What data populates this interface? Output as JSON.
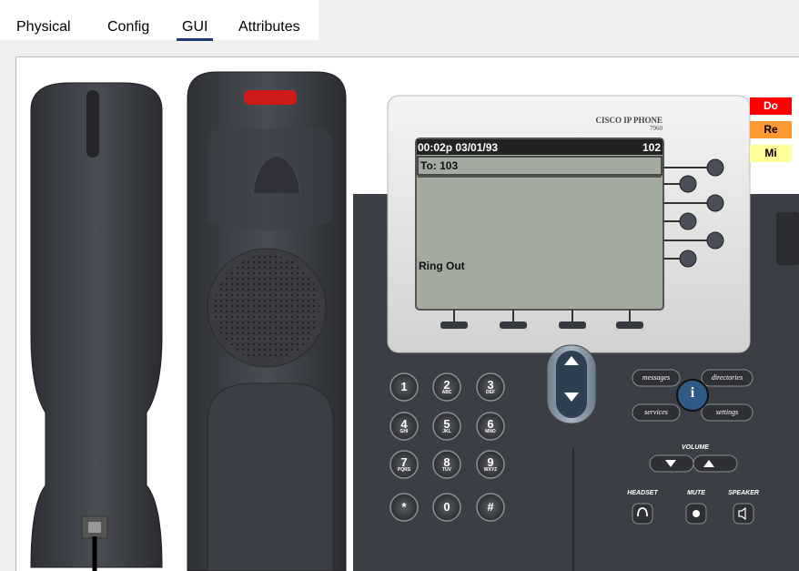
{
  "tabs": [
    {
      "label": "Physical"
    },
    {
      "label": "Config"
    },
    {
      "label": "GUI",
      "active": true
    },
    {
      "label": "Attributes"
    }
  ],
  "phone": {
    "brand": "CISCO IP PHONE",
    "model": "7960",
    "screen": {
      "header_left": "00:02p 03/01/93",
      "header_right": "102",
      "line": "To: 103",
      "status": "Ring Out"
    },
    "softbuttons": [
      "",
      "",
      "",
      ""
    ],
    "keypad": [
      {
        "digit": "1",
        "letters": ""
      },
      {
        "digit": "2",
        "letters": "ABC"
      },
      {
        "digit": "3",
        "letters": "DEF"
      },
      {
        "digit": "4",
        "letters": "GHI"
      },
      {
        "digit": "5",
        "letters": "JKL"
      },
      {
        "digit": "6",
        "letters": "MNO"
      },
      {
        "digit": "7",
        "letters": "PQRS"
      },
      {
        "digit": "8",
        "letters": "TUV"
      },
      {
        "digit": "9",
        "letters": "WXYZ"
      },
      {
        "digit": "*",
        "letters": ""
      },
      {
        "digit": "0",
        "letters": ""
      },
      {
        "digit": "#",
        "letters": ""
      }
    ],
    "function_keys": {
      "messages": "messages",
      "directories": "directories",
      "services": "services",
      "settings": "settings",
      "info": "i"
    },
    "volume_label": "VOLUME",
    "headset_label": "HEADSET",
    "mute_label": "MUTE",
    "speaker_label": "SPEAKER"
  },
  "side_buttons": [
    {
      "label": "Do",
      "color": "#ff0000",
      "text_color": "#ffffff"
    },
    {
      "label": "Re",
      "color": "#ff9933",
      "text_color": "#000000"
    },
    {
      "label": "Mi",
      "color": "#ffff99",
      "text_color": "#000000"
    }
  ]
}
